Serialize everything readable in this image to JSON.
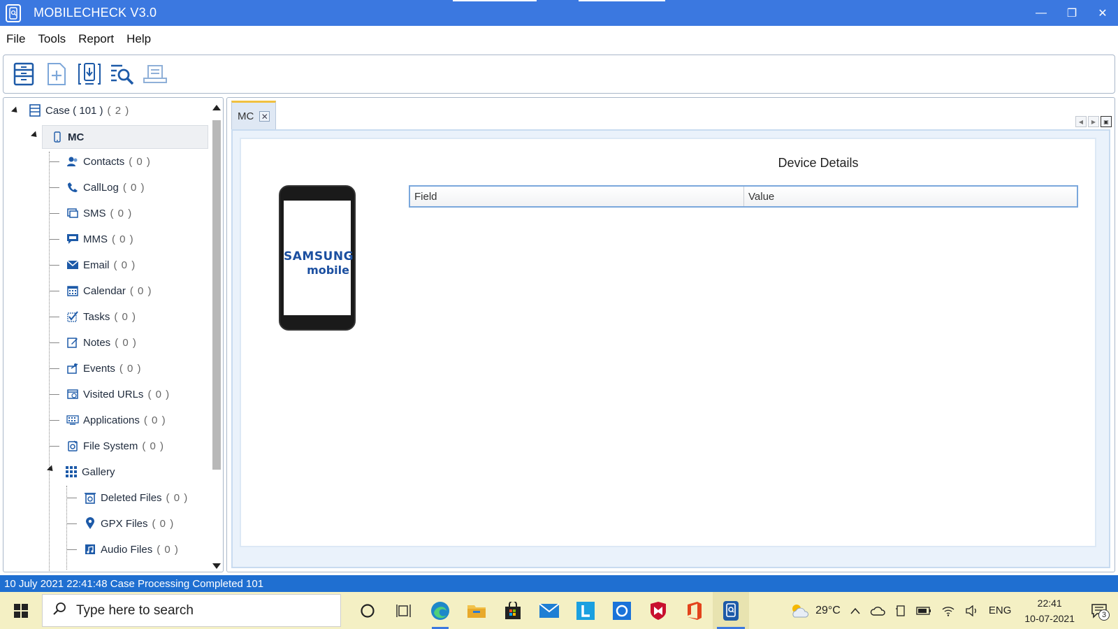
{
  "window": {
    "title": "MOBILECHECK V3.0",
    "minimize_glyph": "—",
    "restore_glyph": "❐",
    "close_glyph": "✕"
  },
  "menu": [
    "File",
    "Tools",
    "Report",
    "Help"
  ],
  "toolbar": {
    "buttons": [
      "open-case-icon",
      "new-case-icon",
      "import-device-icon",
      "search-icon",
      "report-icon"
    ]
  },
  "tree": {
    "root": {
      "label": "Case ( 101 )",
      "count": "( 2 )"
    },
    "device": {
      "label": "MC"
    },
    "items": [
      {
        "label": "Contacts",
        "count": "( 0 )",
        "icon": "contacts-icon"
      },
      {
        "label": "CallLog",
        "count": "( 0 )",
        "icon": "phone-icon"
      },
      {
        "label": "SMS",
        "count": "( 0 )",
        "icon": "sms-icon"
      },
      {
        "label": "MMS",
        "count": "( 0 )",
        "icon": "mms-icon"
      },
      {
        "label": "Email",
        "count": "( 0 )",
        "icon": "email-icon"
      },
      {
        "label": "Calendar",
        "count": "( 0 )",
        "icon": "calendar-icon"
      },
      {
        "label": "Tasks",
        "count": "( 0 )",
        "icon": "tasks-icon"
      },
      {
        "label": "Notes",
        "count": "( 0 )",
        "icon": "notes-icon"
      },
      {
        "label": "Events",
        "count": "( 0 )",
        "icon": "events-icon"
      },
      {
        "label": "Visited URLs",
        "count": "( 0 )",
        "icon": "url-icon"
      },
      {
        "label": "Applications",
        "count": "( 0 )",
        "icon": "applications-icon"
      },
      {
        "label": "File System",
        "count": "( 0 )",
        "icon": "file-system-icon"
      }
    ],
    "gallery": {
      "label": "Gallery",
      "children": [
        {
          "label": "Deleted Files",
          "count": "( 0 )",
          "icon": "deleted-files-icon"
        },
        {
          "label": "GPX Files",
          "count": "( 0 )",
          "icon": "location-pin-icon"
        },
        {
          "label": "Audio Files",
          "count": "( 0 )",
          "icon": "audio-files-icon"
        }
      ]
    }
  },
  "tab": {
    "label": "MC",
    "close_glyph": "✕"
  },
  "device_details": {
    "title": "Device Details",
    "brand_line1": "SAMSUNG",
    "brand_line2": "mobile",
    "columns": [
      "Field",
      "Value"
    ]
  },
  "status": {
    "text": "10 July 2021 22:41:48 Case Processing Completed 101"
  },
  "taskbar": {
    "search_placeholder": "Type here to search",
    "weather": "29°C",
    "language": "ENG",
    "time": "22:41",
    "date": "10-07-2021",
    "notification_count": "3",
    "colors": {
      "accent": "#3b78e0",
      "taskbar_bg": "#f4f0c4",
      "status_bg": "#1f6fd1"
    }
  }
}
